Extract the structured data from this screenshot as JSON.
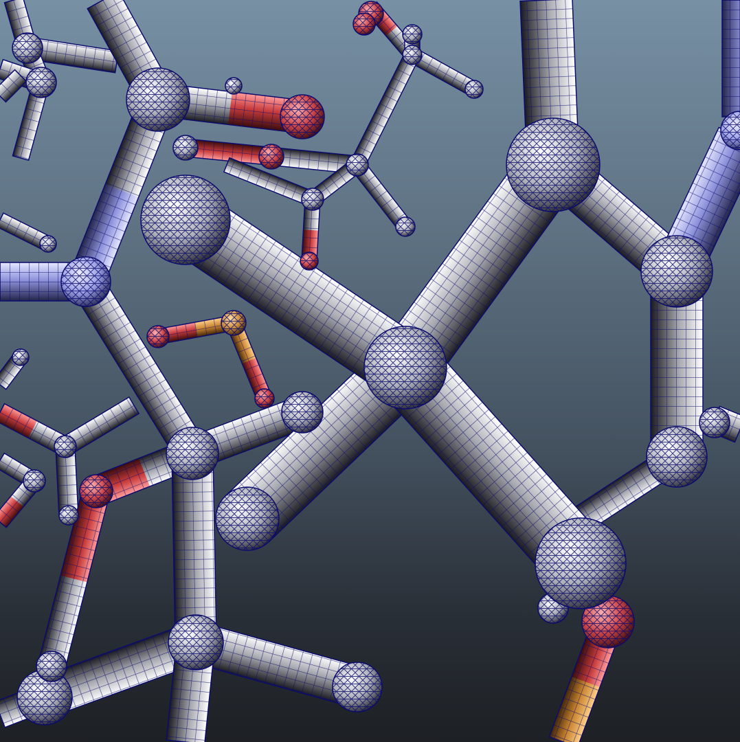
{
  "scene": {
    "kind": "3d-viewport",
    "render_style": "wireframe-on-shaded ball-and-stick molecule",
    "background": {
      "top_color": "#7790a4",
      "bottom_color": "#1d2024"
    },
    "wire_color": "#0c0c6e",
    "atom_colors": {
      "carbon": "#d6d8de",
      "nitrogen": "#aab0f0",
      "oxygen": "#e04848",
      "sulfur": "#e2a040"
    }
  }
}
